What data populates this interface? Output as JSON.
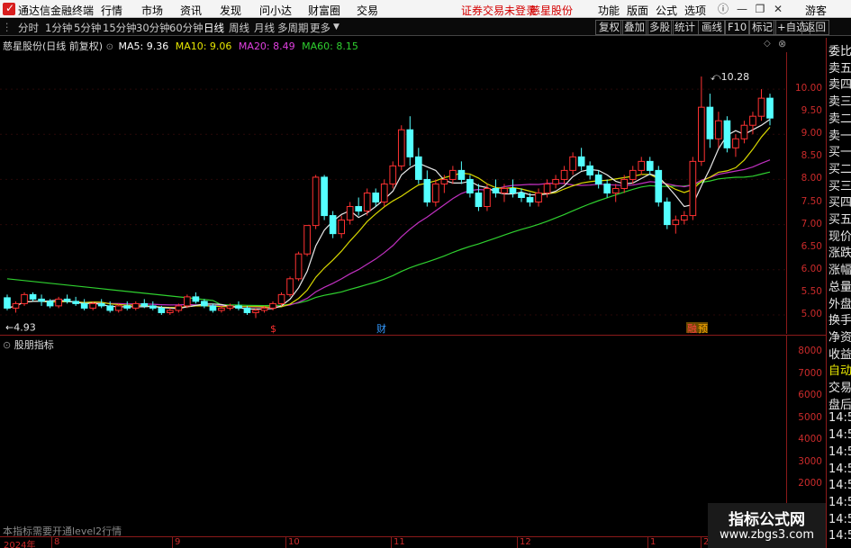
{
  "menubar": {
    "app_title": "通达信金融终端",
    "menus": [
      "行情",
      "市场",
      "资讯",
      "发现",
      "问小达",
      "财富圈",
      "交易"
    ],
    "notice": "证券交易未登录",
    "stock_name": "慈星股份",
    "right_menus": [
      "功能",
      "版面",
      "公式",
      "选项"
    ],
    "user": "游客"
  },
  "toolbar": {
    "periods": [
      "分时",
      "1分钟",
      "5分钟",
      "15分钟",
      "30分钟",
      "60分钟",
      "日线",
      "周线",
      "月线",
      "多周期",
      "更多"
    ],
    "active_period": "日线",
    "right_buttons": [
      "复权",
      "叠加",
      "多股",
      "统计",
      "画线",
      "F10",
      "标记",
      "+自选",
      "返回"
    ]
  },
  "chart_info": {
    "title": "慈星股份(日线 前复权)",
    "ma5": "MA5: 9.36",
    "ma10": "MA10: 9.06",
    "ma20": "MA20: 8.49",
    "ma60": "MA60: 8.15",
    "high_label": "10.28",
    "low_label": "4.93"
  },
  "price_axis": [
    "10.00",
    "9.50",
    "9.00",
    "8.50",
    "8.00",
    "7.50",
    "7.00",
    "6.50",
    "6.00",
    "5.50",
    "5.00"
  ],
  "right_panel": [
    "委比",
    "卖五",
    "卖四",
    "卖三",
    "卖二",
    "卖一",
    "买一",
    "买二",
    "买三",
    "买四",
    "买五",
    "现价",
    "涨跌",
    "涨幅",
    "总量",
    "外盘",
    "换手",
    "净资",
    "收益",
    "自动",
    "交易",
    "盘后",
    "14:5",
    "14:5",
    "14:5",
    "14:5",
    "14:5",
    "14:5",
    "14:5",
    "14:5"
  ],
  "markers": [
    "$",
    "财",
    "融",
    "预"
  ],
  "indicator": {
    "title": "股朋指标",
    "notice": "本指标需要开通level2行情",
    "axis": [
      "8000",
      "7000",
      "6000",
      "5000",
      "4000",
      "3000",
      "2000"
    ]
  },
  "date_axis": [
    "2024年",
    "8",
    "9",
    "10",
    "11",
    "12",
    "1",
    "2"
  ],
  "watermark": {
    "line1": "指标公式网",
    "line2": "www.zbgs3.com"
  },
  "chart_data": {
    "type": "candlestick",
    "ylim": [
      4.7,
      10.5
    ],
    "ohlc": [
      [
        5.38,
        5.45,
        5.1,
        5.15
      ],
      [
        5.15,
        5.3,
        5.05,
        5.25
      ],
      [
        5.25,
        5.5,
        5.2,
        5.45
      ],
      [
        5.45,
        5.5,
        5.3,
        5.35
      ],
      [
        5.35,
        5.45,
        5.2,
        5.3
      ],
      [
        5.3,
        5.35,
        5.15,
        5.2
      ],
      [
        5.2,
        5.4,
        5.15,
        5.35
      ],
      [
        5.35,
        5.45,
        5.25,
        5.3
      ],
      [
        5.3,
        5.4,
        5.2,
        5.25
      ],
      [
        5.25,
        5.35,
        5.1,
        5.15
      ],
      [
        5.15,
        5.3,
        5.1,
        5.25
      ],
      [
        5.25,
        5.35,
        5.15,
        5.2
      ],
      [
        5.2,
        5.3,
        5.05,
        5.1
      ],
      [
        5.1,
        5.25,
        5.05,
        5.2
      ],
      [
        5.2,
        5.3,
        5.1,
        5.15
      ],
      [
        5.15,
        5.3,
        5.1,
        5.25
      ],
      [
        5.25,
        5.35,
        5.15,
        5.2
      ],
      [
        5.2,
        5.3,
        5.1,
        5.15
      ],
      [
        5.15,
        5.2,
        5.0,
        5.05
      ],
      [
        5.05,
        5.15,
        5.0,
        5.1
      ],
      [
        5.1,
        5.25,
        5.05,
        5.2
      ],
      [
        5.2,
        5.45,
        5.15,
        5.4
      ],
      [
        5.4,
        5.5,
        5.25,
        5.3
      ],
      [
        5.3,
        5.35,
        5.15,
        5.2
      ],
      [
        5.2,
        5.25,
        5.05,
        5.1
      ],
      [
        5.1,
        5.2,
        5.05,
        5.15
      ],
      [
        5.15,
        5.25,
        5.1,
        5.2
      ],
      [
        5.2,
        5.3,
        5.1,
        5.15
      ],
      [
        5.15,
        5.2,
        5.0,
        5.05
      ],
      [
        5.05,
        5.15,
        4.93,
        5.1
      ],
      [
        5.1,
        5.2,
        5.05,
        5.15
      ],
      [
        5.15,
        5.3,
        5.1,
        5.25
      ],
      [
        5.25,
        5.5,
        5.2,
        5.45
      ],
      [
        5.45,
        5.85,
        5.4,
        5.8
      ],
      [
        5.8,
        6.4,
        5.75,
        6.35
      ],
      [
        6.35,
        6.98,
        6.3,
        6.98
      ],
      [
        6.98,
        8.1,
        6.9,
        8.05
      ],
      [
        8.05,
        8.1,
        7.1,
        7.2
      ],
      [
        7.2,
        7.3,
        6.7,
        6.8
      ],
      [
        6.8,
        7.2,
        6.7,
        7.1
      ],
      [
        7.1,
        7.5,
        7.0,
        7.4
      ],
      [
        7.4,
        7.6,
        7.2,
        7.3
      ],
      [
        7.3,
        7.8,
        7.2,
        7.7
      ],
      [
        7.7,
        7.8,
        7.4,
        7.5
      ],
      [
        7.5,
        8.0,
        7.4,
        7.9
      ],
      [
        7.9,
        8.4,
        7.8,
        8.3
      ],
      [
        8.3,
        9.2,
        8.2,
        9.1
      ],
      [
        9.1,
        9.4,
        8.3,
        8.5
      ],
      [
        8.5,
        8.7,
        7.9,
        8.0
      ],
      [
        8.0,
        8.2,
        7.4,
        7.5
      ],
      [
        7.5,
        8.0,
        7.4,
        7.9
      ],
      [
        7.9,
        8.1,
        7.7,
        8.0
      ],
      [
        8.0,
        8.3,
        7.9,
        8.2
      ],
      [
        8.2,
        8.4,
        7.9,
        8.0
      ],
      [
        8.0,
        8.1,
        7.6,
        7.7
      ],
      [
        7.7,
        7.9,
        7.3,
        7.4
      ],
      [
        7.4,
        7.9,
        7.3,
        7.8
      ],
      [
        7.8,
        8.0,
        7.6,
        7.7
      ],
      [
        7.7,
        7.9,
        7.5,
        7.8
      ],
      [
        7.8,
        8.0,
        7.6,
        7.7
      ],
      [
        7.7,
        7.8,
        7.5,
        7.6
      ],
      [
        7.6,
        7.7,
        7.4,
        7.5
      ],
      [
        7.5,
        7.8,
        7.4,
        7.7
      ],
      [
        7.7,
        8.0,
        7.6,
        7.9
      ],
      [
        7.9,
        8.1,
        7.8,
        8.0
      ],
      [
        8.0,
        8.3,
        7.9,
        8.2
      ],
      [
        8.2,
        8.6,
        8.1,
        8.5
      ],
      [
        8.5,
        8.7,
        8.2,
        8.3
      ],
      [
        8.3,
        8.4,
        8.0,
        8.1
      ],
      [
        8.1,
        8.2,
        7.8,
        7.9
      ],
      [
        7.9,
        8.0,
        7.6,
        7.7
      ],
      [
        7.7,
        7.9,
        7.5,
        7.8
      ],
      [
        7.8,
        8.1,
        7.7,
        8.0
      ],
      [
        8.0,
        8.3,
        7.9,
        8.2
      ],
      [
        8.2,
        8.5,
        8.1,
        8.4
      ],
      [
        8.4,
        8.5,
        8.1,
        8.2
      ],
      [
        8.2,
        8.3,
        7.4,
        7.5
      ],
      [
        7.5,
        7.6,
        6.9,
        7.0
      ],
      [
        7.0,
        7.2,
        6.8,
        7.1
      ],
      [
        7.1,
        7.3,
        7.0,
        7.2
      ],
      [
        7.2,
        8.5,
        7.1,
        8.4
      ],
      [
        8.4,
        10.28,
        8.3,
        9.6
      ],
      [
        9.6,
        9.9,
        8.7,
        8.9
      ],
      [
        8.9,
        9.5,
        8.7,
        9.3
      ],
      [
        9.3,
        9.4,
        8.6,
        8.7
      ],
      [
        8.7,
        9.0,
        8.5,
        8.9
      ],
      [
        8.9,
        9.3,
        8.8,
        9.2
      ],
      [
        9.2,
        9.5,
        9.0,
        9.4
      ],
      [
        9.4,
        10.0,
        9.3,
        9.8
      ],
      [
        9.8,
        9.9,
        9.2,
        9.36
      ]
    ]
  }
}
